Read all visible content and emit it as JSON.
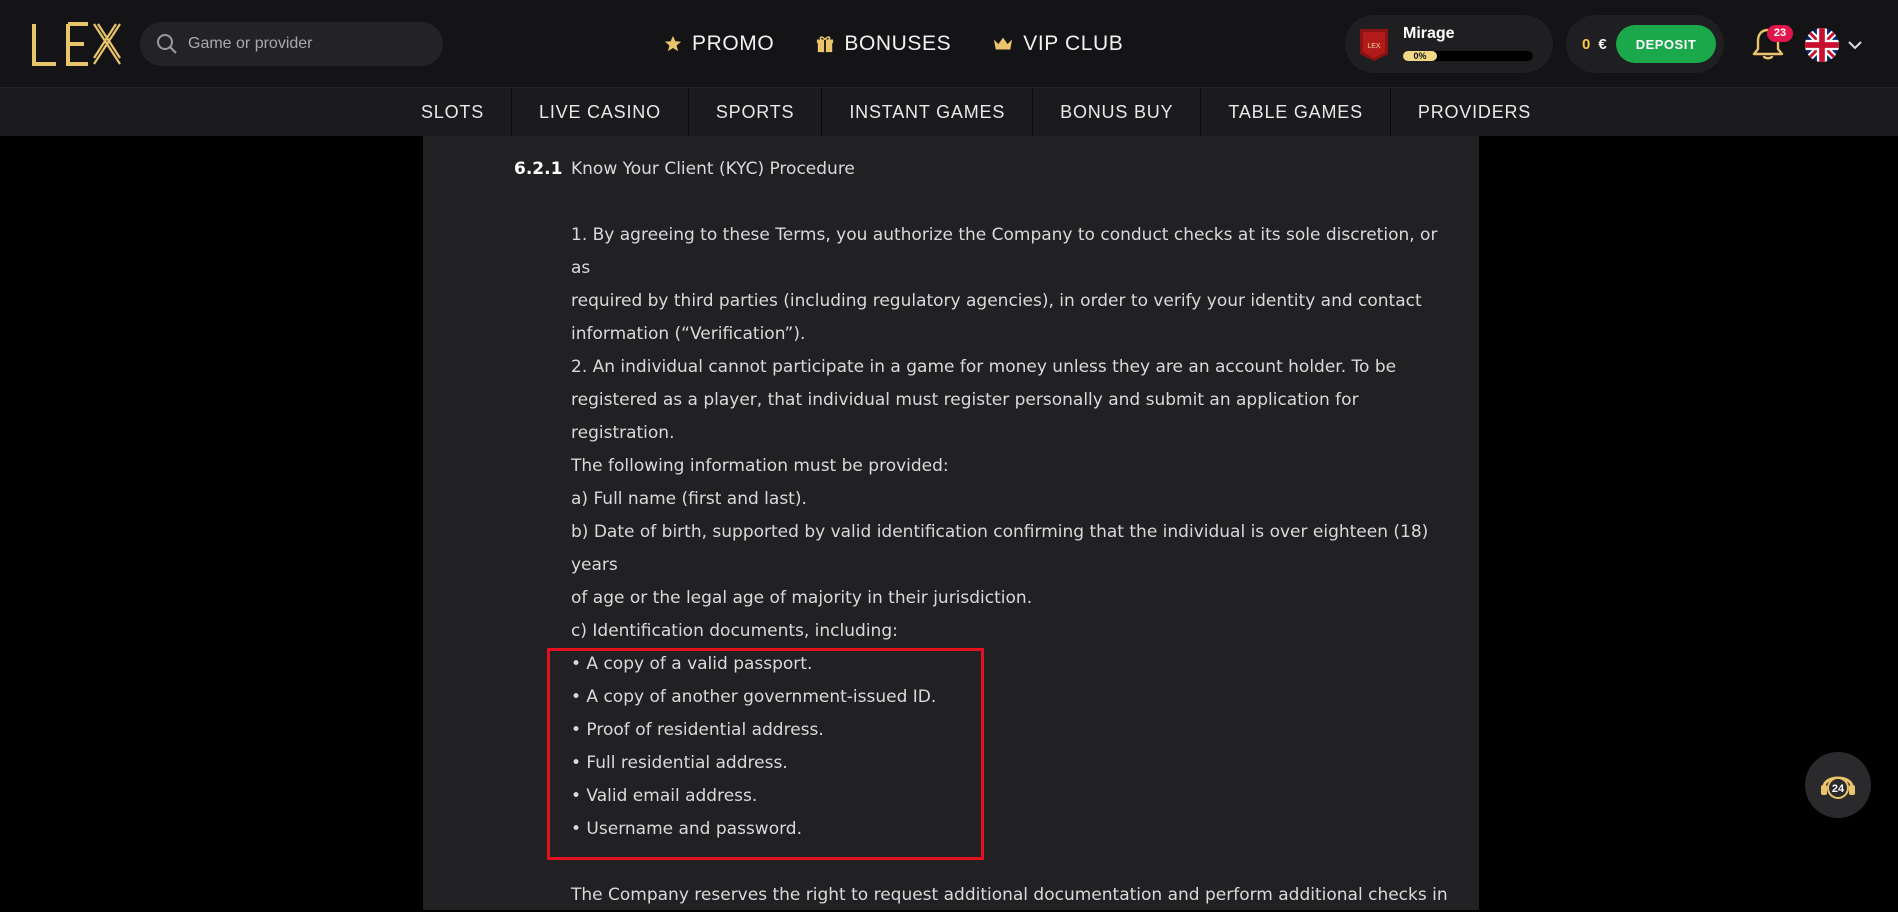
{
  "header": {
    "logo_text": "LEX",
    "search": {
      "placeholder": "Game or provider"
    },
    "nav": [
      {
        "label": "PROMO",
        "icon": "star-icon"
      },
      {
        "label": "BONUSES",
        "icon": "gift-icon"
      },
      {
        "label": "VIP CLUB",
        "icon": "crown-icon"
      }
    ],
    "profile": {
      "name": "Mirage",
      "badge_text": "LEX",
      "progress_label": "0%",
      "progress": 0
    },
    "wallet": {
      "balance": "0",
      "currency": "€",
      "deposit_label": "DEPOSIT"
    },
    "notifications": {
      "count": "23"
    },
    "language": {
      "flag": "uk-flag-icon"
    }
  },
  "categories": [
    "SLOTS",
    "LIVE CASINO",
    "SPORTS",
    "INSTANT GAMES",
    "BONUS BUY",
    "TABLE GAMES",
    "PROVIDERS"
  ],
  "document": {
    "section_number": "6.2.1",
    "section_title": "Know Your Client (KYC) Procedure",
    "p1": [
      "1. By agreeing to these Terms, you authorize the Company to conduct checks at its sole discretion, or as",
      "required by third parties (including regulatory agencies), in order to verify your identity and contact",
      "information (“Verification”)."
    ],
    "p2": [
      "2. An individual cannot participate in a game for money unless they are an account holder. To be",
      "registered as a player, that individual must register personally and submit an application for registration.",
      "The following information must be provided:"
    ],
    "p3": [
      "a) Full name (first and last).",
      "b) Date of birth, supported by valid identification confirming that the individual is over eighteen (18) years",
      "of age or the legal age of majority in their jurisdiction.",
      "c) Identification documents, including:"
    ],
    "bullets": [
      "• A copy of a valid passport.",
      "• A copy of another government-issued ID.",
      "• Proof of residential address.",
      "• Full residential address.",
      "• Valid email address.",
      "• Username and password."
    ],
    "p4": [
      "The Company reserves the right to request additional documentation and perform additional checks in"
    ]
  },
  "support": {
    "label": "24"
  },
  "colors": {
    "accent_gold": "#e9c46a",
    "deposit_green": "#1aa84a",
    "highlight_red": "#e3101f",
    "badge_pink": "#e0154b"
  }
}
